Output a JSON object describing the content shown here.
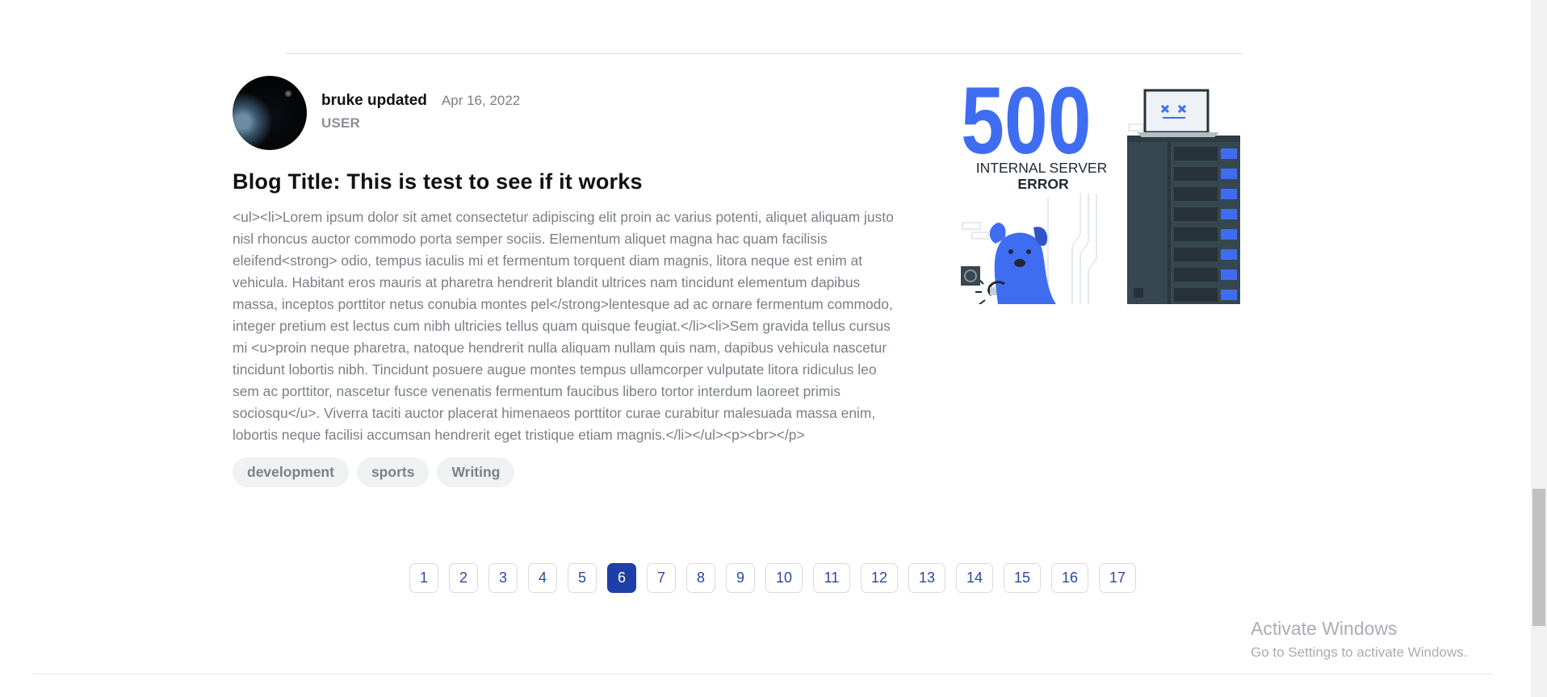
{
  "post": {
    "author_name": "bruke updated",
    "date": "Apr 16, 2022",
    "role": "USER",
    "title": "Blog Title: This is test to see if it works",
    "body": "<ul><li>Lorem ipsum dolor sit amet consectetur adipiscing elit proin ac varius potenti, aliquet aliquam justo nisl rhoncus auctor commodo porta semper sociis. Elementum aliquet magna hac quam facilisis eleifend<strong> odio, tempus iaculis mi et fermentum torquent diam magnis, litora neque est enim at vehicula. Habitant eros mauris at pharetra hendrerit blandit ultrices nam tincidunt elementum dapibus massa, inceptos porttitor netus conubia montes pel</strong>lentesque ad ac ornare fermentum commodo, integer pretium est lectus cum nibh ultricies tellus quam quisque feugiat.</li><li>Sem gravida tellus cursus mi <u>proin neque pharetra, natoque hendrerit nulla aliquam nullam quis nam, dapibus vehicula nascetur tincidunt lobortis nibh. Tincidunt posuere augue montes tempus ullamcorper vulputate litora ridiculus leo sem ac porttitor, nascetur fusce venenatis fermentum faucibus libero tortor interdum laoreet primis sociosqu</u>. Viverra taciti auctor placerat himenaeos porttitor curae curabitur malesuada massa enim, lobortis neque facilisi accumsan hendrerit eget tristique etiam magnis.</li></ul><p><br></p>",
    "tags": [
      "development",
      "sports",
      "Writing"
    ]
  },
  "hero_image": {
    "code": "500",
    "line1": "INTERNAL SERVER",
    "line2": "ERROR",
    "accent_color": "#3f6df2",
    "server_color": "#37474f"
  },
  "pagination": {
    "pages": [
      "1",
      "2",
      "3",
      "4",
      "5",
      "6",
      "7",
      "8",
      "9",
      "10",
      "11",
      "12",
      "13",
      "14",
      "15",
      "16",
      "17"
    ],
    "current": "6",
    "active_color": "#1e40a6"
  },
  "watermark": {
    "title": "Activate Windows",
    "subtitle": "Go to Settings to activate Windows."
  }
}
